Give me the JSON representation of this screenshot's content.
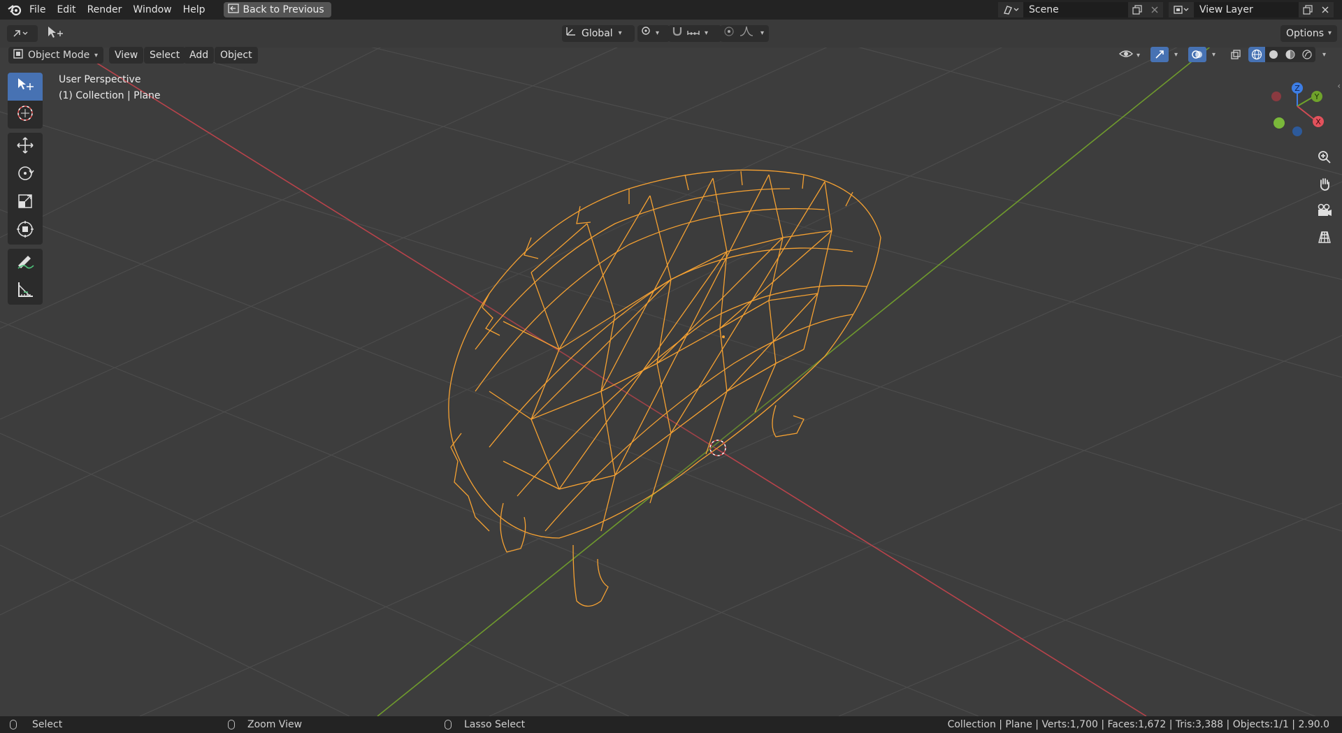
{
  "menu": {
    "items": [
      "File",
      "Edit",
      "Render",
      "Window",
      "Help"
    ],
    "back_label": "Back to Previous"
  },
  "scene": {
    "value": "Scene"
  },
  "view_layer": {
    "value": "View Layer"
  },
  "toolbar": {
    "transform_orientation": "Global",
    "options_label": "Options"
  },
  "viewport_header": {
    "mode": "Object Mode",
    "menus": [
      "View",
      "Select",
      "Add",
      "Object"
    ]
  },
  "overlay": {
    "perspective": "User Perspective",
    "collection": "(1) Collection | Plane"
  },
  "gizmo": {
    "z": "Z",
    "y": "Y",
    "x": "X"
  },
  "statusbar": {
    "left": "Select",
    "middle": "Zoom View",
    "right": "Lasso Select",
    "stats": "Collection | Plane | Verts:1,700 | Faces:1,672 | Tris:3,388 | Objects:1/1 | 2.90.0"
  },
  "colors": {
    "wire": "#f5a132",
    "x_axis": "#b8434b",
    "y_axis": "#6f9a2d",
    "active_tool": "#4772b3"
  }
}
